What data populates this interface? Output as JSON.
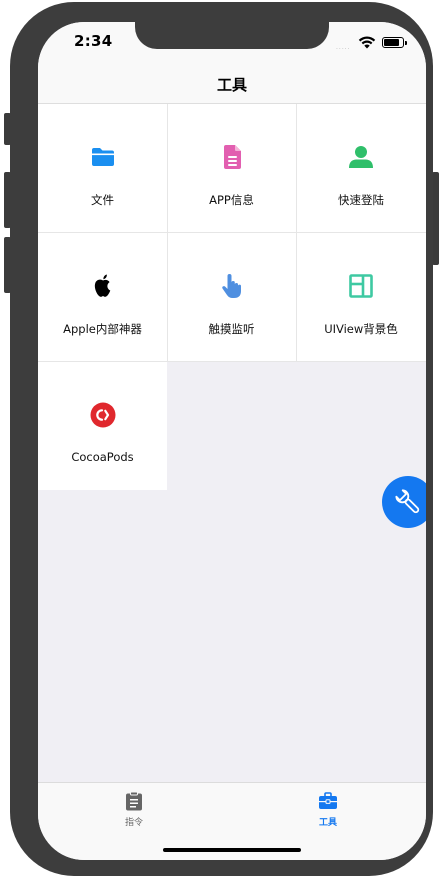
{
  "status_bar": {
    "time": "2:34",
    "signal": "....."
  },
  "navbar": {
    "title": "工具"
  },
  "tools": [
    {
      "label": "文件",
      "icon": "folder-icon",
      "color": "#1a8ff0"
    },
    {
      "label": "APP信息",
      "icon": "document-icon",
      "color": "#e25fb0"
    },
    {
      "label": "快速登陆",
      "icon": "user-icon",
      "color": "#2fbf6a"
    },
    {
      "label": "Apple内部神器",
      "icon": "apple-icon",
      "color": "#000000"
    },
    {
      "label": "触摸监听",
      "icon": "pointing-hand-icon",
      "color": "#4f8fe0"
    },
    {
      "label": "UIView背景色",
      "icon": "layout-panel-icon",
      "color": "#3ec9a2"
    },
    {
      "label": "CocoaPods",
      "icon": "cocoapods-icon",
      "color": "#e0282d"
    }
  ],
  "fab": {
    "icon": "wrench-icon",
    "color": "#1478f0"
  },
  "tabbar": {
    "tabs": [
      {
        "label": "指令",
        "icon": "clipboard-icon",
        "color": "#666666",
        "active": false
      },
      {
        "label": "工具",
        "icon": "toolbox-icon",
        "color": "#1478f0",
        "active": true
      }
    ]
  }
}
